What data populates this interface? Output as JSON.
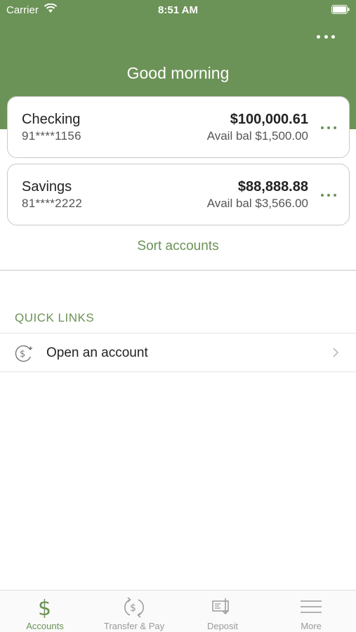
{
  "status_bar": {
    "carrier": "Carrier",
    "time": "8:51 AM"
  },
  "header": {
    "greeting": "Good morning"
  },
  "accounts": [
    {
      "name": "Checking",
      "number": "91****1156",
      "balance": "$100,000.61",
      "avail": "Avail bal $1,500.00"
    },
    {
      "name": "Savings",
      "number": "81****2222",
      "balance": "$88,888.88",
      "avail": "Avail bal $3,566.00"
    }
  ],
  "sort_label": "Sort accounts",
  "quick_links": {
    "title": "QUICK LINKS",
    "items": [
      {
        "label": "Open an account",
        "icon": "dollar-plus-icon"
      }
    ]
  },
  "tabbar": {
    "tabs": [
      {
        "label": "Accounts",
        "icon": "dollar-icon",
        "active": true
      },
      {
        "label": "Transfer & Pay",
        "icon": "transfer-icon",
        "active": false
      },
      {
        "label": "Deposit",
        "icon": "check-deposit-icon",
        "active": false
      },
      {
        "label": "More",
        "icon": "menu-icon",
        "active": false
      }
    ]
  },
  "colors": {
    "brand_green": "#6c9357",
    "inactive_gray": "#9a9a9a"
  }
}
